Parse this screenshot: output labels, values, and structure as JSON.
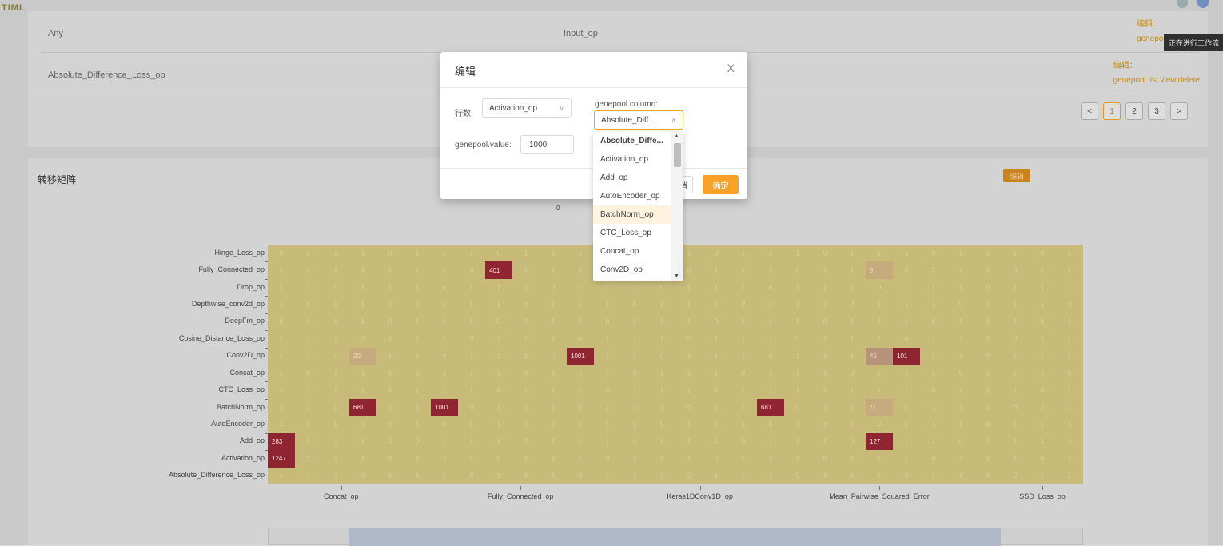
{
  "header": {
    "logo_text": "TIML"
  },
  "tooltip": "正在进行工作流",
  "table": {
    "rows": [
      {
        "col1": "Any",
        "col2": "Input_op",
        "op1": "编辑：",
        "op2": "genepool.list.view"
      },
      {
        "col1": "Absolute_Difference_Loss_op",
        "col2": "",
        "op1": "编辑：",
        "op2": "genepool.list.view.delete"
      }
    ],
    "pagination": {
      "prev": "<",
      "pages": [
        "1",
        "2",
        "3"
      ],
      "next": ">",
      "current": "1"
    }
  },
  "matrix": {
    "title": "转移矩阵",
    "edit_label": "编辑",
    "scale_min_label": "0",
    "y_labels": [
      "Hinge_Loss_op",
      "Fully_Connected_op",
      "Drop_op",
      "Depthwise_conv2d_op",
      "DeepFm_op",
      "Cosine_Distance_Loss_op",
      "Conv2D_op",
      "Concat_op",
      "CTC_Loss_op",
      "BatchNorm_op",
      "AutoEncoder_op",
      "Add_op",
      "Activation_op",
      "Absolute_Difference_Loss_op"
    ],
    "x_labels": [
      "Concat_op",
      "Fully_Connected_op",
      "Keras1DConv1D_op",
      "Mean_Pairwise_Squared_Error",
      "SSD_Loss_op"
    ],
    "highlight_cells": [
      {
        "row": 1,
        "col": 8,
        "value": "401",
        "level": "dark"
      },
      {
        "row": 6,
        "col": 3,
        "value": "20",
        "level": "light"
      },
      {
        "row": 6,
        "col": 11,
        "value": "1001",
        "level": "dark"
      },
      {
        "row": 6,
        "col": 22,
        "value": "45",
        "level": "mid"
      },
      {
        "row": 6,
        "col": 23,
        "value": "101",
        "level": "dark"
      },
      {
        "row": 9,
        "col": 3,
        "value": "681",
        "level": "dark"
      },
      {
        "row": 9,
        "col": 6,
        "value": "1001",
        "level": "dark"
      },
      {
        "row": 9,
        "col": 18,
        "value": "681",
        "level": "dark"
      },
      {
        "row": 9,
        "col": 22,
        "value": "11",
        "level": "light"
      },
      {
        "row": 11,
        "col": 0,
        "value": "283",
        "level": "dark"
      },
      {
        "row": 11,
        "col": 22,
        "value": "127",
        "level": "dark"
      },
      {
        "row": 12,
        "col": 0,
        "value": "1247",
        "level": "dark"
      },
      {
        "row": 1,
        "col": 22,
        "value": "9",
        "level": "light"
      }
    ],
    "colors": {
      "base": "#c8bb7a",
      "dark": "#8e2531",
      "mid": "#b7937a",
      "light": "#c6ab7e"
    }
  },
  "modal": {
    "title": "编辑",
    "close": "X",
    "row_label": "行数:",
    "row_value": "Activation_op",
    "column_label": "genepool.column:",
    "column_value": "Absolute_Diff...",
    "value_label": "genepool.value:",
    "value_input": "1000",
    "cancel_label": "消",
    "ok_label": "确定"
  },
  "dropdown": {
    "options": [
      "Absolute_Diffe...",
      "Activation_op",
      "Add_op",
      "AutoEncoder_op",
      "BatchNorm_op",
      "CTC_Loss_op",
      "Concat_op",
      "Conv2D_op"
    ],
    "selected_index": 0,
    "hover_index": 4
  }
}
